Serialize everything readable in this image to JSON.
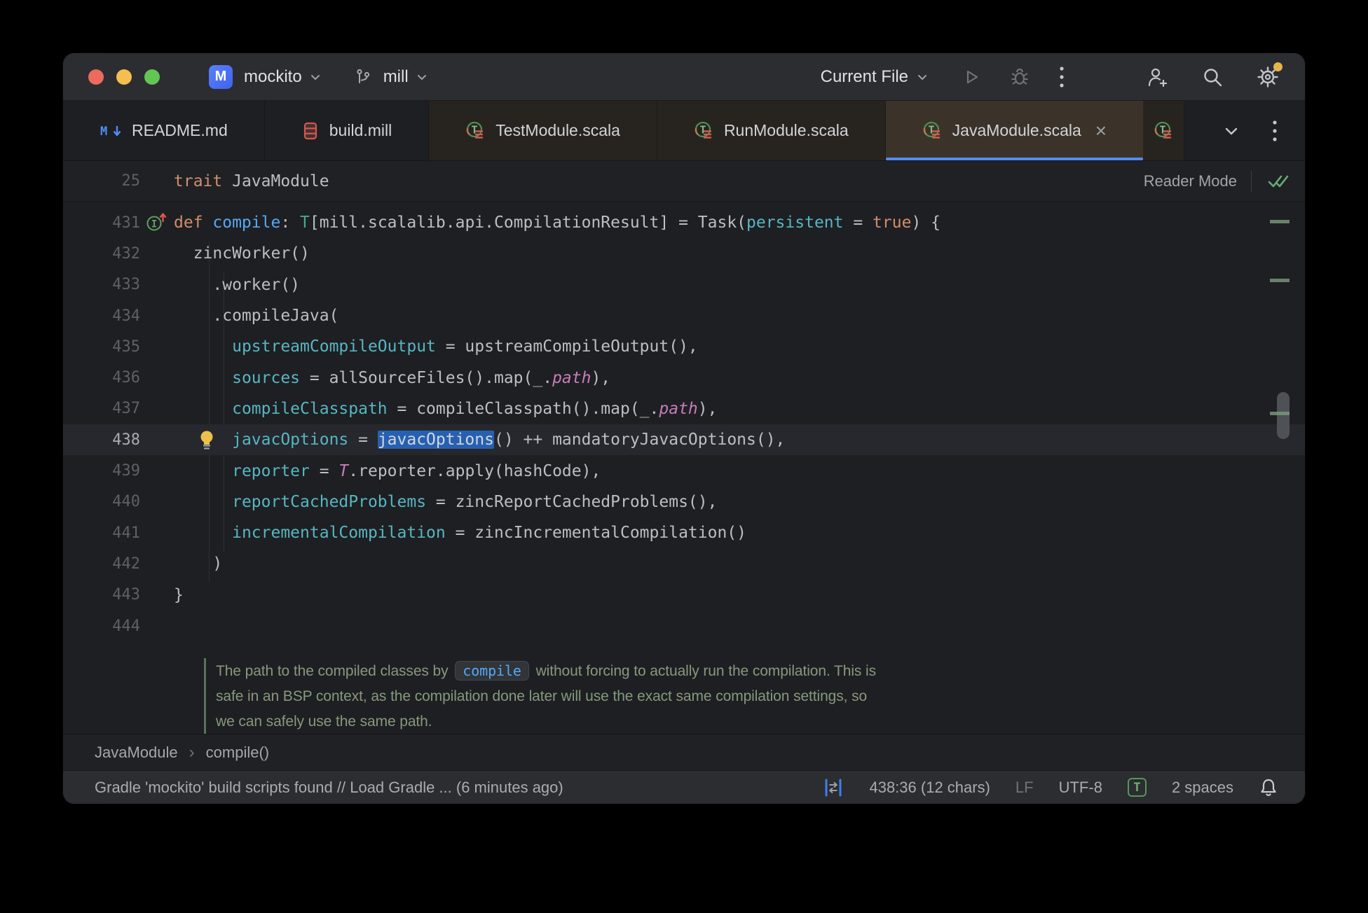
{
  "titlebar": {
    "project_initial": "M",
    "project": "mockito",
    "branch": "mill",
    "run_config": "Current File"
  },
  "tabs": [
    {
      "label": "README.md",
      "icon": "markdown-file",
      "group": "plain"
    },
    {
      "label": "build.mill",
      "icon": "mill-file",
      "group": "plain"
    },
    {
      "label": "TestModule.scala",
      "icon": "scala-trait",
      "group": "warm"
    },
    {
      "label": "RunModule.scala",
      "icon": "scala-trait",
      "group": "warm"
    },
    {
      "label": "JavaModule.scala",
      "icon": "scala-trait",
      "group": "warm",
      "active": true,
      "close": true
    },
    {
      "label": "",
      "icon": "scala-trait",
      "group": "warm",
      "partial": true
    }
  ],
  "sticky": {
    "line_number": "25",
    "keyword": "trait ",
    "title": "JavaModule",
    "reader_mode_label": "Reader Mode"
  },
  "editor": {
    "lines": [
      {
        "num": "431",
        "gutter_icon": "override-up",
        "tokens": [
          [
            "kw",
            "def "
          ],
          [
            "fn",
            "compile"
          ],
          [
            "d",
            ": "
          ],
          [
            "ty",
            "T"
          ],
          [
            "d",
            "[mill.scalalib.api.CompilationResult] = Task("
          ],
          [
            "pa",
            "persistent"
          ],
          [
            "d",
            " = "
          ],
          [
            "kw",
            "true"
          ],
          [
            "d",
            ") {"
          ]
        ]
      },
      {
        "num": "432",
        "tokens": [
          [
            "d",
            "  zincWorker()"
          ]
        ]
      },
      {
        "num": "433",
        "tokens": [
          [
            "d",
            "    .worker()"
          ]
        ]
      },
      {
        "num": "434",
        "tokens": [
          [
            "d",
            "    .compileJava("
          ]
        ]
      },
      {
        "num": "435",
        "tokens": [
          [
            "d",
            "      "
          ],
          [
            "pa",
            "upstreamCompileOutput"
          ],
          [
            "d",
            " = upstreamCompileOutput(),"
          ]
        ]
      },
      {
        "num": "436",
        "tokens": [
          [
            "d",
            "      "
          ],
          [
            "pa",
            "sources"
          ],
          [
            "d",
            " = allSourceFiles().map(_."
          ],
          [
            "it",
            "path"
          ],
          [
            "d",
            "),"
          ]
        ]
      },
      {
        "num": "437",
        "tokens": [
          [
            "d",
            "      "
          ],
          [
            "pa",
            "compileClasspath"
          ],
          [
            "d",
            " = compileClasspath().map(_."
          ],
          [
            "it",
            "path"
          ],
          [
            "d",
            "),"
          ]
        ]
      },
      {
        "num": "438",
        "current": true,
        "gutter_icon": "lightbulb",
        "tokens": [
          [
            "d",
            "      "
          ],
          [
            "pa",
            "javacOptions"
          ],
          [
            "d",
            " = "
          ],
          [
            "sel",
            "javacOptions"
          ],
          [
            "d",
            "() ++ mandatoryJavacOptions(),"
          ]
        ]
      },
      {
        "num": "439",
        "tokens": [
          [
            "d",
            "      "
          ],
          [
            "pa",
            "reporter"
          ],
          [
            "d",
            " = "
          ],
          [
            "it",
            "T"
          ],
          [
            "d",
            ".reporter.apply(hashCode),"
          ]
        ]
      },
      {
        "num": "440",
        "tokens": [
          [
            "d",
            "      "
          ],
          [
            "pa",
            "reportCachedProblems"
          ],
          [
            "d",
            " = zincReportCachedProblems(),"
          ]
        ]
      },
      {
        "num": "441",
        "tokens": [
          [
            "d",
            "      "
          ],
          [
            "pa",
            "incrementalCompilation"
          ],
          [
            "d",
            " = zincIncrementalCompilation()"
          ]
        ]
      },
      {
        "num": "442",
        "tokens": [
          [
            "d",
            "    )"
          ]
        ]
      },
      {
        "num": "443",
        "tokens": [
          [
            "d",
            "}"
          ]
        ]
      },
      {
        "num": "444",
        "tokens": []
      }
    ],
    "doc": {
      "lines": [
        [
          {
            "t": "The path to the compiled classes by "
          },
          {
            "chip": "compile"
          },
          {
            "t": " without forcing to actually run the compilation. This is"
          }
        ],
        [
          {
            "t": "safe in an BSP context, as the compilation done later will use the exact same compilation settings, so"
          }
        ],
        [
          {
            "t": "we can safely use the same path."
          }
        ]
      ]
    }
  },
  "breadcrumbs": [
    "JavaModule",
    "compile()"
  ],
  "statusbar": {
    "message": "Gradle 'mockito' build scripts found // Load Gradle ... (6 minutes ago)",
    "caret": "438:36 (12 chars)",
    "line_ending": "LF",
    "encoding": "UTF-8",
    "type_badge": "T",
    "indent": "2 spaces"
  },
  "colors": {
    "accent_blue": "#548af7",
    "selection_blue": "#2760b0",
    "keyword_orange": "#cf8e6d",
    "function_blue": "#56a8f5",
    "param_cyan": "#56b6c2",
    "type_teal": "#46a894",
    "purple_italic": "#c77dbb",
    "doc_green": "#87997d",
    "traffic_red": "#ed6a5e",
    "traffic_yellow": "#f5bf4f",
    "traffic_green": "#62c554",
    "notification_yellow": "#e8b54a"
  }
}
